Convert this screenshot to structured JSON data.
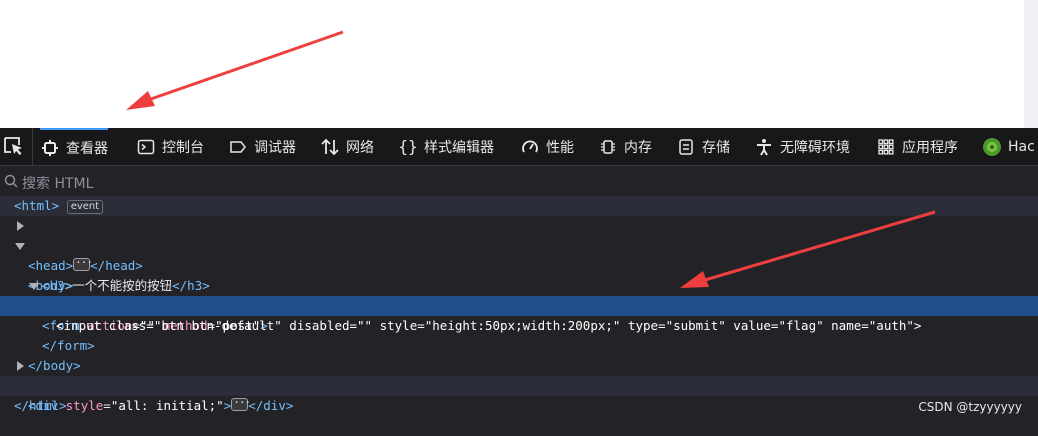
{
  "toolbar": {
    "tabs": [
      {
        "label": "查看器",
        "icon": "inspector-icon",
        "active": true
      },
      {
        "label": "控制台",
        "icon": "console-icon"
      },
      {
        "label": "调试器",
        "icon": "debugger-icon"
      },
      {
        "label": "网络",
        "icon": "network-icon"
      },
      {
        "label": "样式编辑器",
        "icon": "style-editor-icon"
      },
      {
        "label": "性能",
        "icon": "performance-icon"
      },
      {
        "label": "内存",
        "icon": "memory-icon"
      },
      {
        "label": "存储",
        "icon": "storage-icon"
      },
      {
        "label": "无障碍环境",
        "icon": "accessibility-icon"
      },
      {
        "label": "应用程序",
        "icon": "application-icon"
      },
      {
        "label": "Hac",
        "icon": "hackbar-icon"
      }
    ]
  },
  "search": {
    "placeholder": "搜索 HTML"
  },
  "tree": {
    "html_open": "<html>",
    "event_badge": "event",
    "head_open": "<head>",
    "head_close": "</head>",
    "body_open": "<body>",
    "h3_open": "<h3>",
    "h3_text": "一个不能按的按钮",
    "h3_close": "</h3>",
    "form_tag": "<form",
    "form_attr1": "action",
    "form_val1": "\"\"",
    "form_attr2": "method",
    "form_val2": "\"post\"",
    "form_end": ">",
    "input_line": "<input class=\"btn btn-default\" disabled=\"\" style=\"height:50px;width:200px;\" type=\"submit\" value=\"flag\" name=\"auth\">",
    "form_close": "</form>",
    "body_close": "</body>",
    "div_tag": "<div",
    "div_attr": "style",
    "div_val": "\"all: initial;\"",
    "div_end": ">",
    "div_close": "</div>",
    "html_close": "</html>"
  },
  "annotations": {
    "arrow_color": "#ef3e3e"
  },
  "watermark": "CSDN @tzyyyyyy"
}
